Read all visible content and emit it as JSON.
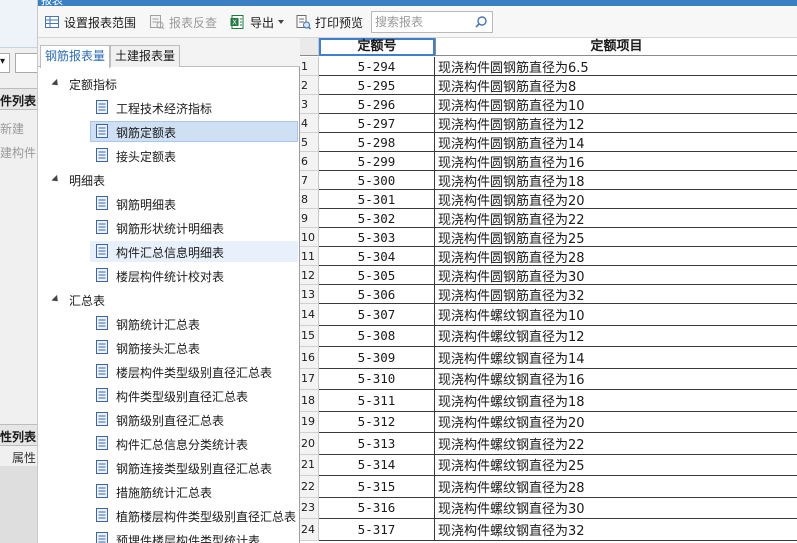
{
  "background_window": {
    "frag_combo_char": "▾",
    "frag_list1": "件列表",
    "frag_new": "新建",
    "frag_component": "建构件…",
    "frag_list2": "性列表",
    "frag_attr": "属性"
  },
  "dialog": {
    "title": "报表"
  },
  "toolbar": {
    "set_range": "设置报表范围",
    "check_report": "报表反查",
    "export": "导出",
    "print_preview": "打印预览",
    "search_placeholder": "搜索报表"
  },
  "tabs": [
    {
      "label": "钢筋报表量",
      "active": true
    },
    {
      "label": "土建报表量",
      "active": false
    }
  ],
  "tree": [
    {
      "label": "定额指标",
      "items": [
        {
          "label": "工程技术经济指标"
        },
        {
          "label": "钢筋定额表",
          "selected": true
        },
        {
          "label": "接头定额表"
        }
      ]
    },
    {
      "label": "明细表",
      "items": [
        {
          "label": "钢筋明细表"
        },
        {
          "label": "钢筋形状统计明细表"
        },
        {
          "label": "构件汇总信息明细表",
          "hover": true
        },
        {
          "label": "楼层构件统计校对表"
        }
      ]
    },
    {
      "label": "汇总表",
      "items": [
        {
          "label": "钢筋统计汇总表"
        },
        {
          "label": "钢筋接头汇总表"
        },
        {
          "label": "楼层构件类型级别直径汇总表"
        },
        {
          "label": "构件类型级别直径汇总表"
        },
        {
          "label": "钢筋级别直径汇总表"
        },
        {
          "label": "构件汇总信息分类统计表"
        },
        {
          "label": "钢筋连接类型级别直径汇总表"
        },
        {
          "label": "措施筋统计汇总表"
        },
        {
          "label": "植筋楼层构件类型级别直径汇总表"
        },
        {
          "label": "预埋件楼层构件类型统计表"
        }
      ]
    }
  ],
  "grid": {
    "columns": [
      "定额号",
      "定额项目"
    ],
    "rows": [
      {
        "num": "1",
        "code": "5-294",
        "item": "现浇构件圆钢筋直径为6.5"
      },
      {
        "num": "2",
        "code": "5-295",
        "item": "现浇构件圆钢筋直径为8"
      },
      {
        "num": "3",
        "code": "5-296",
        "item": "现浇构件圆钢筋直径为10"
      },
      {
        "num": "4",
        "code": "5-297",
        "item": "现浇构件圆钢筋直径为12"
      },
      {
        "num": "5",
        "code": "5-298",
        "item": "现浇构件圆钢筋直径为14"
      },
      {
        "num": "6",
        "code": "5-299",
        "item": "现浇构件圆钢筋直径为16"
      },
      {
        "num": "7",
        "code": "5-300",
        "item": "现浇构件圆钢筋直径为18"
      },
      {
        "num": "8",
        "code": "5-301",
        "item": "现浇构件圆钢筋直径为20"
      },
      {
        "num": "9",
        "code": "5-302",
        "item": "现浇构件圆钢筋直径为22"
      },
      {
        "num": "10",
        "code": "5-303",
        "item": "现浇构件圆钢筋直径为25"
      },
      {
        "num": "11",
        "code": "5-304",
        "item": "现浇构件圆钢筋直径为28"
      },
      {
        "num": "12",
        "code": "5-305",
        "item": "现浇构件圆钢筋直径为30"
      },
      {
        "num": "13",
        "code": "5-306",
        "item": "现浇构件圆钢筋直径为32"
      },
      {
        "num": "14",
        "code": "5-307",
        "item": "现浇构件螺纹钢直径为10"
      },
      {
        "num": "15",
        "code": "5-308",
        "item": "现浇构件螺纹钢直径为12"
      },
      {
        "num": "16",
        "code": "5-309",
        "item": "现浇构件螺纹钢直径为14"
      },
      {
        "num": "17",
        "code": "5-310",
        "item": "现浇构件螺纹钢直径为16"
      },
      {
        "num": "18",
        "code": "5-311",
        "item": "现浇构件螺纹钢直径为18"
      },
      {
        "num": "19",
        "code": "5-312",
        "item": "现浇构件螺纹钢直径为20"
      },
      {
        "num": "20",
        "code": "5-313",
        "item": "现浇构件螺纹钢直径为22"
      },
      {
        "num": "21",
        "code": "5-314",
        "item": "现浇构件螺纹钢直径为25"
      },
      {
        "num": "22",
        "code": "5-315",
        "item": "现浇构件螺纹钢直径为28"
      },
      {
        "num": "23",
        "code": "5-316",
        "item": "现浇构件螺纹钢直径为30"
      },
      {
        "num": "24",
        "code": "5-317",
        "item": "现浇构件螺纹钢直径为32"
      }
    ]
  },
  "colors": {
    "accent": "#2d6cb3",
    "selection": "#cfe0f4",
    "header_border": "#3f7fd0"
  }
}
